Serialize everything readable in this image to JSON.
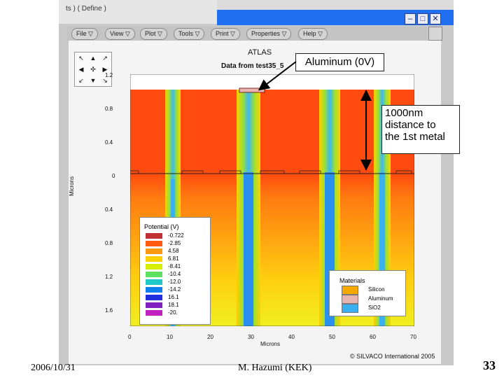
{
  "window": {
    "title_fragment": "ts  )   (  Define  )",
    "controls": [
      "–",
      "□",
      "✕"
    ]
  },
  "menu": [
    {
      "label": "File ▽"
    },
    {
      "label": "View ▽"
    },
    {
      "label": "Plot ▽"
    },
    {
      "label": "Tools ▽"
    },
    {
      "label": "Print ▽"
    },
    {
      "label": "Properties ▽"
    },
    {
      "label": "Help ▽"
    }
  ],
  "plot": {
    "title": "ATLAS",
    "subtitle": "Data from test35_5",
    "y_axis_label": "Microns",
    "x_axis_label": "Microns",
    "y_ticks": [
      "1.2",
      "0.8",
      "0.4",
      "0",
      "0.4",
      "0.8",
      "1.2",
      "1.6"
    ],
    "x_ticks": [
      "0",
      "10",
      "20",
      "30",
      "40",
      "50",
      "60",
      "70"
    ],
    "copyright": "© SILVACO International 2005"
  },
  "potential_legend": {
    "title": "Potential (V)",
    "entries": [
      {
        "label": "-0.722",
        "color": "#c03030"
      },
      {
        "label": "-2.85",
        "color": "#ff5a10"
      },
      {
        "label": "4.58",
        "color": "#ff9a10"
      },
      {
        "label": "6.81",
        "color": "#ffd000"
      },
      {
        "label": "-8.41",
        "color": "#d8f000"
      },
      {
        "label": "-10.4",
        "color": "#60e060"
      },
      {
        "label": "-12.0",
        "color": "#20c8c8"
      },
      {
        "label": "-14.2",
        "color": "#1080f0"
      },
      {
        "label": "16.1",
        "color": "#2030e0"
      },
      {
        "label": "18.1",
        "color": "#8020c0"
      },
      {
        "label": "-20.",
        "color": "#c020c0"
      }
    ]
  },
  "materials_legend": {
    "title": "Materials",
    "entries": [
      {
        "label": "Silicon",
        "color": "#f4a800"
      },
      {
        "label": "Aluminum",
        "color": "#e8b4b0"
      },
      {
        "label": "SiO2",
        "color": "#3bb0f0"
      }
    ]
  },
  "annotations": {
    "aluminum": "Aluminum (0V)",
    "distance_line1": "1000nm",
    "distance_line2": "distance to",
    "distance_line3": "the 1st metal"
  },
  "footer": {
    "date": "2006/10/31",
    "author": "M. Hazumi (KEK)",
    "page": "33"
  }
}
